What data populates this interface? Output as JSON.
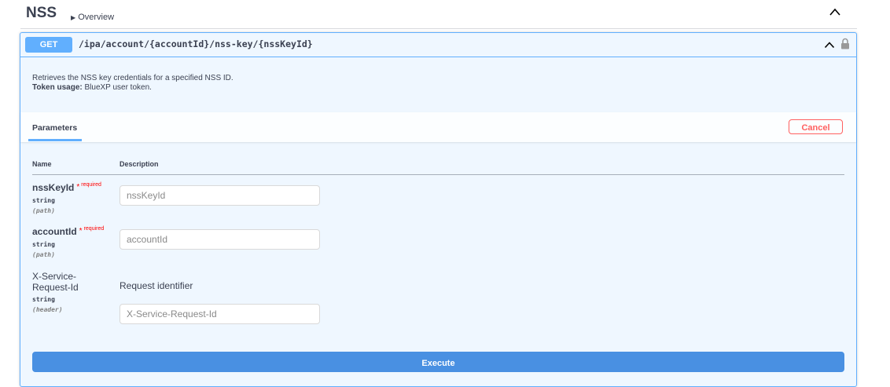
{
  "tag": {
    "name": "NSS",
    "description_arrow": "▶",
    "description": "Overview"
  },
  "operation": {
    "method": "GET",
    "path": "/ipa/account/{accountId}/nss-key/{nssKeyId}",
    "summary": "Retrieves the NSS key credentials for a specified NSS ID.",
    "token_label": "Token usage:",
    "token_value": "BlueXP user token."
  },
  "parameters_panel": {
    "tab_label": "Parameters",
    "cancel_label": "Cancel",
    "col_name": "Name",
    "col_description": "Description",
    "execute_label": "Execute"
  },
  "params": [
    {
      "name": "nssKeyId",
      "required_star": "*",
      "required_label": "required",
      "type": "string",
      "in": "(path)",
      "placeholder": "nssKeyId"
    },
    {
      "name": "accountId",
      "required_star": "*",
      "required_label": "required",
      "type": "string",
      "in": "(path)",
      "placeholder": "accountId"
    },
    {
      "name_line1": "X-Service-",
      "name_line2": "Request-Id",
      "type": "string",
      "in": "(header)",
      "description": "Request identifier",
      "placeholder": "X-Service-Request-Id"
    }
  ],
  "colors": {
    "get_blue": "#61affe",
    "execute_blue": "#4990e2",
    "cancel_red": "#ff6060",
    "required_red": "#ff0000"
  },
  "icons": {
    "tag_toggle": "chevron-up-icon",
    "op_toggle": "chevron-up-icon",
    "auth": "lock-icon"
  }
}
